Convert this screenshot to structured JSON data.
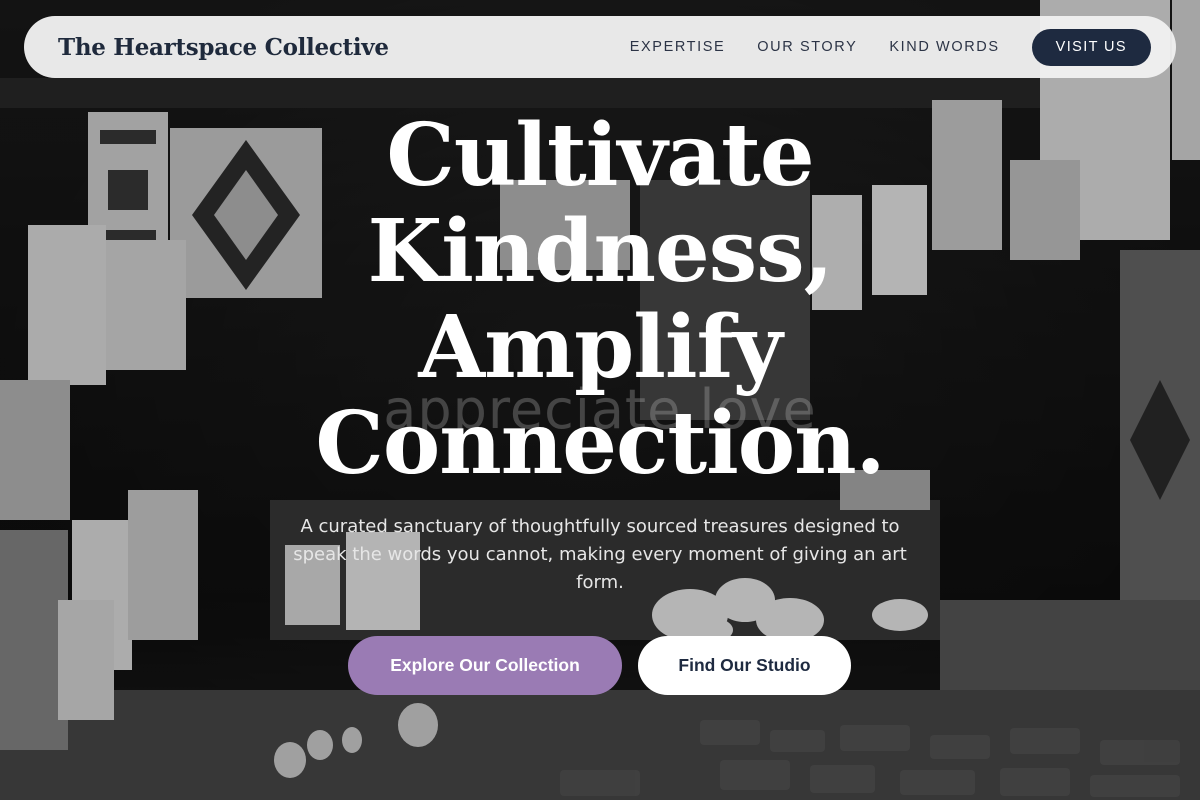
{
  "brand": {
    "name": "The Heartspace Collective"
  },
  "nav": {
    "links": [
      "EXPERTISE",
      "OUR STORY",
      "KIND WORDS"
    ],
    "cta": "VISIT US"
  },
  "hero": {
    "headline": [
      "Cultivate",
      "Kindness,",
      "Amplify",
      "Connection."
    ],
    "watermark": "appreciate love",
    "subtitle": "A curated sanctuary of thoughtfully sourced treasures designed to speak the words you cannot, making every moment of giving an art form.",
    "primary_cta": "Explore Our Collection",
    "secondary_cta": "Find Our Studio"
  },
  "colors": {
    "navy": "#1e2a40",
    "lavender": "#9a7bb4",
    "nav_bg": "#f0f0f0"
  }
}
